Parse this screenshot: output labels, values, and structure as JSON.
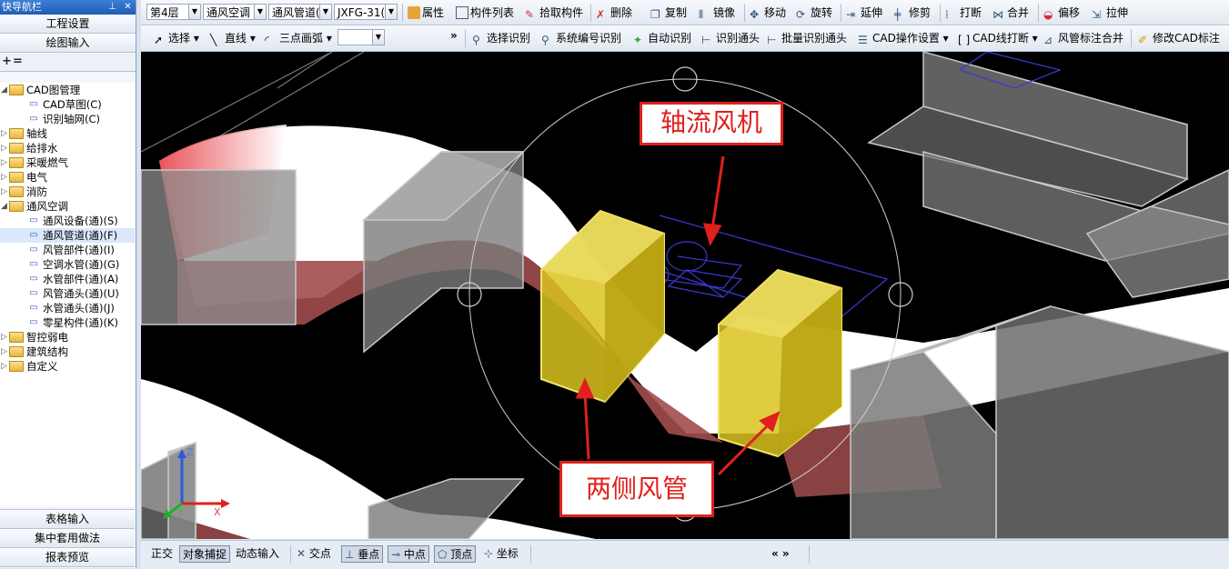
{
  "nav": {
    "title": "快导航栏",
    "top_buttons": [
      "工程设置",
      "绘图输入"
    ],
    "tree": [
      {
        "label": "CAD图管理",
        "level": 0,
        "type": "folder",
        "expanded": true
      },
      {
        "label": "CAD草图(C)",
        "level": 1,
        "type": "leaf"
      },
      {
        "label": "识别轴网(C)",
        "level": 1,
        "type": "leaf"
      },
      {
        "label": "轴线",
        "level": 0,
        "type": "folder"
      },
      {
        "label": "给排水",
        "level": 0,
        "type": "folder"
      },
      {
        "label": "采暖燃气",
        "level": 0,
        "type": "folder"
      },
      {
        "label": "电气",
        "level": 0,
        "type": "folder"
      },
      {
        "label": "消防",
        "level": 0,
        "type": "folder"
      },
      {
        "label": "通风空调",
        "level": 0,
        "type": "folder",
        "expanded": true
      },
      {
        "label": "通风设备(通)(S)",
        "level": 1,
        "type": "leaf"
      },
      {
        "label": "通风管道(通)(F)",
        "level": 1,
        "type": "leaf",
        "selected": true
      },
      {
        "label": "风管部件(通)(I)",
        "level": 1,
        "type": "leaf"
      },
      {
        "label": "空调水管(通)(G)",
        "level": 1,
        "type": "leaf"
      },
      {
        "label": "水管部件(通)(A)",
        "level": 1,
        "type": "leaf"
      },
      {
        "label": "风管通头(通)(U)",
        "level": 1,
        "type": "leaf"
      },
      {
        "label": "水管通头(通)(J)",
        "level": 1,
        "type": "leaf"
      },
      {
        "label": "零星构件(通)(K)",
        "level": 1,
        "type": "leaf"
      },
      {
        "label": "智控弱电",
        "level": 0,
        "type": "folder"
      },
      {
        "label": "建筑结构",
        "level": 0,
        "type": "folder"
      },
      {
        "label": "自定义",
        "level": 0,
        "type": "folder"
      }
    ],
    "bottom_buttons": [
      "表格输入",
      "集中套用做法",
      "报表预览"
    ]
  },
  "toolbar1": {
    "floor": "第4层",
    "discipline": "通风空调",
    "component_type": "通风管道(",
    "component": "JXFG-31(",
    "buttons": [
      "属性",
      "构件列表",
      "拾取构件",
      "删除",
      "复制",
      "镜像",
      "移动",
      "旋转",
      "延伸",
      "修剪",
      "打断",
      "合并",
      "偏移",
      "拉伸"
    ]
  },
  "toolbar2": {
    "buttons": [
      "选择",
      "直线",
      "三点画弧",
      "选择识别",
      "系统编号识别",
      "自动识别",
      "识别通头",
      "批量识别通头",
      "CAD操作设置",
      "CAD线打断",
      "风管标注合并",
      "修改CAD标注"
    ],
    "overflow": "»"
  },
  "viewport": {
    "callout_fan": "轴流风机",
    "callout_ducts": "两侧风管",
    "axis_labels": {
      "z": "Z",
      "y": "Y",
      "x": "X"
    },
    "colors": {
      "background": "#000000",
      "duct": "#9a9a9a",
      "selected_duct": "#d9c320",
      "callout": "#e0201c",
      "hidden_face": "#a14c4c"
    }
  },
  "status": {
    "buttons": [
      "正交",
      "对象捕捉",
      "动态输入",
      "交点",
      "垂点",
      "中点",
      "顶点",
      "坐标"
    ],
    "pressed": [
      "对象捕捉",
      "垂点",
      "中点",
      "顶点"
    ],
    "nav_arrows": "« »"
  }
}
